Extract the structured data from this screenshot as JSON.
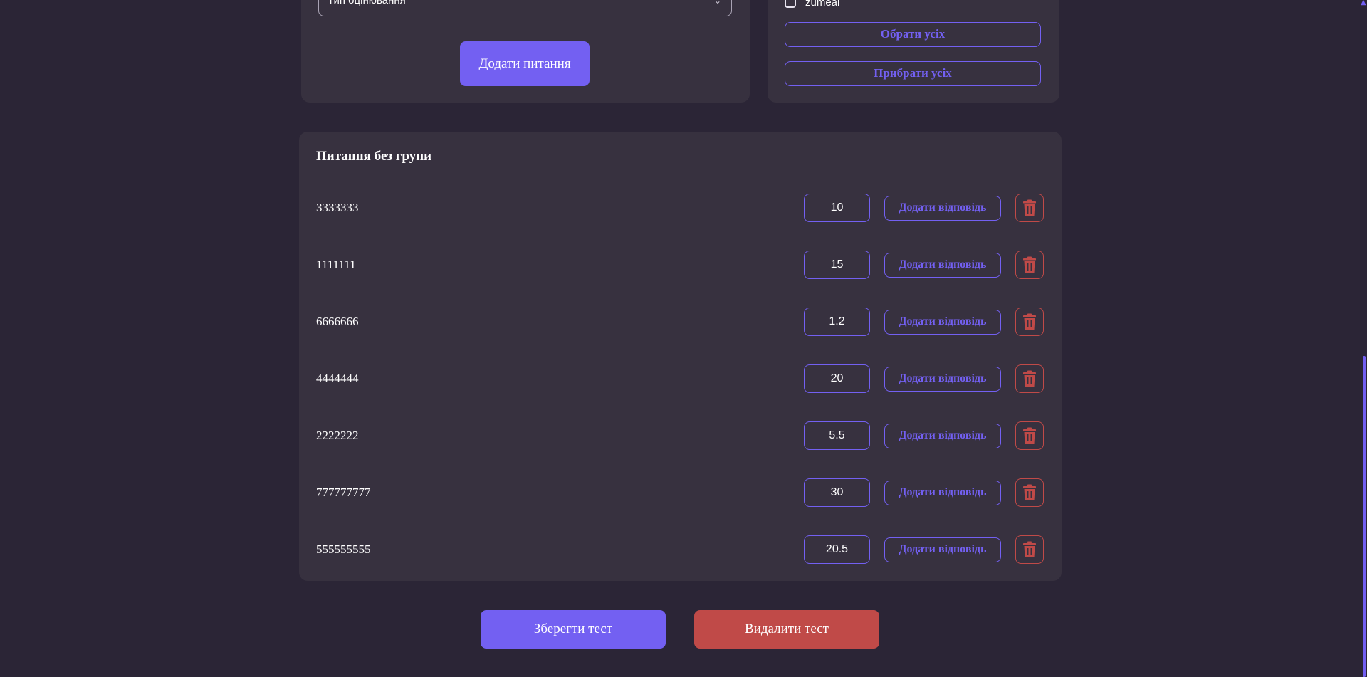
{
  "form": {
    "grading_type_select": "Тип оцінювання",
    "add_question_label": "Додати питання"
  },
  "groups": {
    "items": [
      {
        "label": "zumeal",
        "checked": false
      }
    ],
    "select_all_label": "Обрати усіх",
    "remove_all_label": "Прибрати усіх"
  },
  "questions": {
    "section_title": "Питання без групи",
    "add_answer_label": "Додати відповідь",
    "items": [
      {
        "text": "3333333",
        "points": "10"
      },
      {
        "text": "1111111",
        "points": "15"
      },
      {
        "text": "6666666",
        "points": "1.2"
      },
      {
        "text": "4444444",
        "points": "20"
      },
      {
        "text": "2222222",
        "points": "5.5"
      },
      {
        "text": "777777777",
        "points": "30"
      },
      {
        "text": "555555555",
        "points": "20.5"
      }
    ]
  },
  "actions": {
    "save_label": "Зберегти тест",
    "delete_label": "Видалити тест"
  },
  "colors": {
    "background": "#2b2536",
    "card": "#37313f",
    "accent": "#7360f2",
    "danger": "#c04a48"
  },
  "icons": {
    "delete": "trash-icon",
    "select": "chevron-down-icon"
  }
}
